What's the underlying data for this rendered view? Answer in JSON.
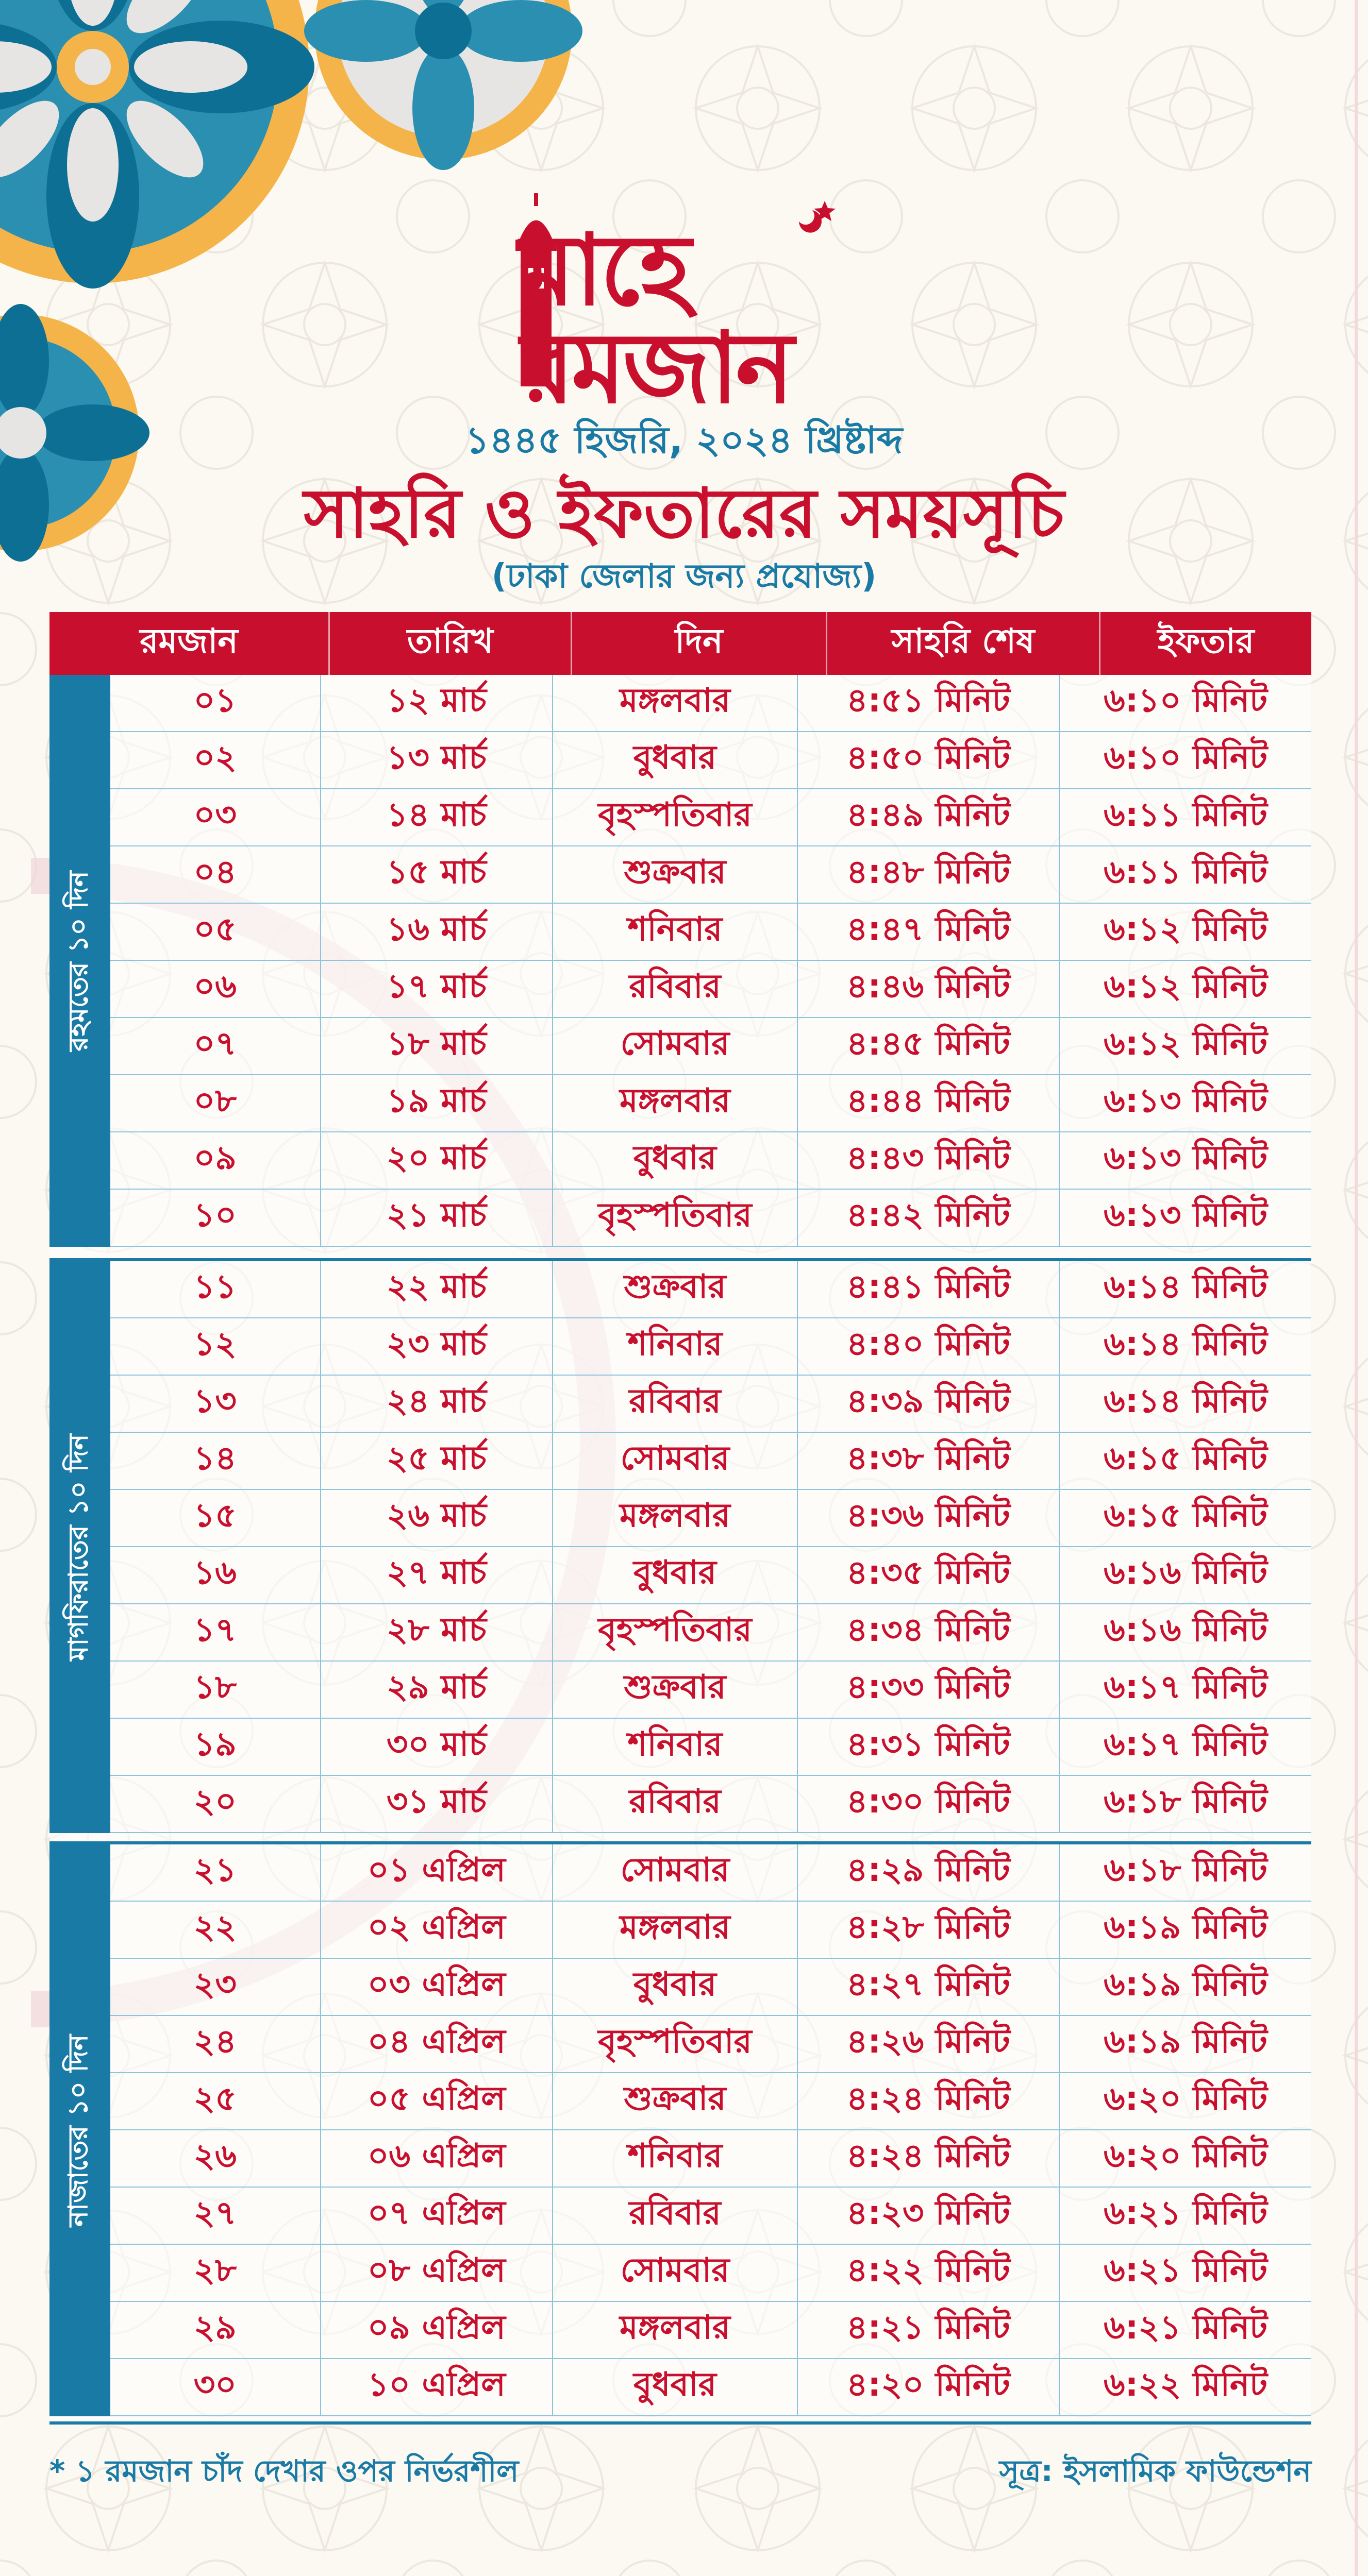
{
  "logo": {
    "text": "মাহে রমজান"
  },
  "header": {
    "hijri_line": "১৪৪৫ হিজরি, ২০২৪ খ্রিষ্টাব্দ",
    "title": "সাহরি ও ইফতারের সময়সূচি",
    "subtitle": "(ঢাকা জেলার জন্য প্রযোজ্য)"
  },
  "colors": {
    "primary_red": "#c8102e",
    "primary_blue": "#1a7aa6",
    "background": "#fbf9f1"
  },
  "table": {
    "headers": [
      "রমজান",
      "তারিখ",
      "দিন",
      "সাহরি শেষ",
      "ইফতার"
    ],
    "sections": [
      {
        "label": "রহমতের ১০ দিন",
        "rows": [
          [
            "০১",
            "১২ মার্চ",
            "মঙ্গলবার",
            "৪:৫১ মিনিট",
            "৬:১০ মিনিট"
          ],
          [
            "০২",
            "১৩ মার্চ",
            "বুধবার",
            "৪:৫০ মিনিট",
            "৬:১০ মিনিট"
          ],
          [
            "০৩",
            "১৪ মার্চ",
            "বৃহস্পতিবার",
            "৪:৪৯ মিনিট",
            "৬:১১ মিনিট"
          ],
          [
            "০৪",
            "১৫ মার্চ",
            "শুক্রবার",
            "৪:৪৮ মিনিট",
            "৬:১১ মিনিট"
          ],
          [
            "০৫",
            "১৬ মার্চ",
            "শনিবার",
            "৪:৪৭ মিনিট",
            "৬:১২ মিনিট"
          ],
          [
            "০৬",
            "১৭ মার্চ",
            "রবিবার",
            "৪:৪৬ মিনিট",
            "৬:১২ মিনিট"
          ],
          [
            "০৭",
            "১৮ মার্চ",
            "সোমবার",
            "৪:৪৫ মিনিট",
            "৬:১২ মিনিট"
          ],
          [
            "০৮",
            "১৯ মার্চ",
            "মঙ্গলবার",
            "৪:৪৪ মিনিট",
            "৬:১৩ মিনিট"
          ],
          [
            "০৯",
            "২০ মার্চ",
            "বুধবার",
            "৪:৪৩ মিনিট",
            "৬:১৩ মিনিট"
          ],
          [
            "১০",
            "২১ মার্চ",
            "বৃহস্পতিবার",
            "৪:৪২ মিনিট",
            "৬:১৩ মিনিট"
          ]
        ]
      },
      {
        "label": "মাগফিরাতের ১০ দিন",
        "rows": [
          [
            "১১",
            "২২ মার্চ",
            "শুক্রবার",
            "৪:৪১ মিনিট",
            "৬:১৪ মিনিট"
          ],
          [
            "১২",
            "২৩ মার্চ",
            "শনিবার",
            "৪:৪০ মিনিট",
            "৬:১৪ মিনিট"
          ],
          [
            "১৩",
            "২৪ মার্চ",
            "রবিবার",
            "৪:৩৯ মিনিট",
            "৬:১৪ মিনিট"
          ],
          [
            "১৪",
            "২৫ মার্চ",
            "সোমবার",
            "৪:৩৮ মিনিট",
            "৬:১৫ মিনিট"
          ],
          [
            "১৫",
            "২৬ মার্চ",
            "মঙ্গলবার",
            "৪:৩৬ মিনিট",
            "৬:১৫ মিনিট"
          ],
          [
            "১৬",
            "২৭ মার্চ",
            "বুধবার",
            "৪:৩৫ মিনিট",
            "৬:১৬ মিনিট"
          ],
          [
            "১৭",
            "২৮ মার্চ",
            "বৃহস্পতিবার",
            "৪:৩৪ মিনিট",
            "৬:১৬ মিনিট"
          ],
          [
            "১৮",
            "২৯ মার্চ",
            "শুক্রবার",
            "৪:৩৩ মিনিট",
            "৬:১৭ মিনিট"
          ],
          [
            "১৯",
            "৩০ মার্চ",
            "শনিবার",
            "৪:৩১ মিনিট",
            "৬:১৭ মিনিট"
          ],
          [
            "২০",
            "৩১ মার্চ",
            "রবিবার",
            "৪:৩০ মিনিট",
            "৬:১৮ মিনিট"
          ]
        ]
      },
      {
        "label": "নাজাতের ১০ দিন",
        "rows": [
          [
            "২১",
            "০১ এপ্রিল",
            "সোমবার",
            "৪:২৯ মিনিট",
            "৬:১৮ মিনিট"
          ],
          [
            "২২",
            "০২ এপ্রিল",
            "মঙ্গলবার",
            "৪:২৮ মিনিট",
            "৬:১৯ মিনিট"
          ],
          [
            "২৩",
            "০৩ এপ্রিল",
            "বুধবার",
            "৪:২৭ মিনিট",
            "৬:১৯ মিনিট"
          ],
          [
            "২৪",
            "০৪ এপ্রিল",
            "বৃহস্পতিবার",
            "৪:২৬ মিনিট",
            "৬:১৯ মিনিট"
          ],
          [
            "২৫",
            "০৫ এপ্রিল",
            "শুক্রবার",
            "৪:২৪ মিনিট",
            "৬:২০ মিনিট"
          ],
          [
            "২৬",
            "০৬ এপ্রিল",
            "শনিবার",
            "৪:২৪ মিনিট",
            "৬:২০ মিনিট"
          ],
          [
            "২৭",
            "০৭ এপ্রিল",
            "রবিবার",
            "৪:২৩ মিনিট",
            "৬:২১ মিনিট"
          ],
          [
            "২৮",
            "০৮ এপ্রিল",
            "সোমবার",
            "৪:২২ মিনিট",
            "৬:২১ মিনিট"
          ],
          [
            "২৯",
            "০৯ এপ্রিল",
            "মঙ্গলবার",
            "৪:২১ মিনিট",
            "৬:২১ মিনিট"
          ],
          [
            "৩০",
            "১০ এপ্রিল",
            "বুধবার",
            "৪:২০ মিনিট",
            "৬:২২ মিনিট"
          ]
        ]
      }
    ]
  },
  "footer": {
    "note": "* ১ রমজান চাঁদ দেখার ওপর নির্ভরশীল",
    "source": "সূত্র: ইসলামিক ফাউন্ডেশন"
  }
}
